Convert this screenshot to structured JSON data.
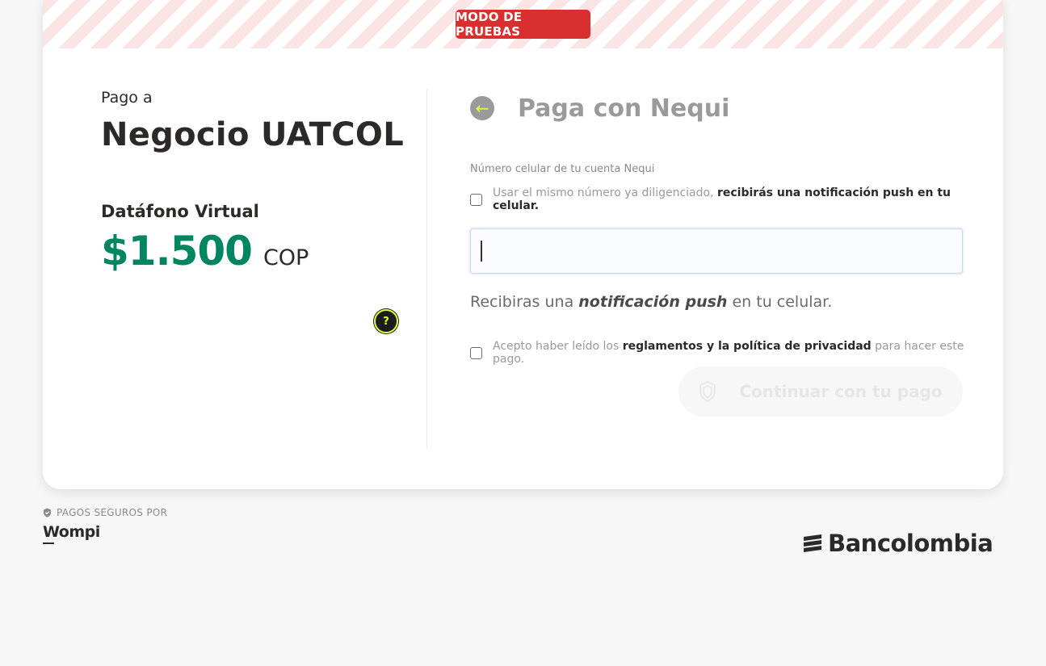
{
  "banner": {
    "test_mode_label": "MODO DE PRUEBAS"
  },
  "summary": {
    "pay_to_label": "Pago a",
    "merchant_name": "Negocio UATCOL",
    "product_name": "Datáfono Virtual",
    "amount": "$1.500",
    "currency": "COP",
    "help_icon": "?"
  },
  "payment": {
    "back_icon": "←",
    "title": "Paga con Nequi",
    "phone_label": "Número celular de tu cuenta Nequi",
    "same_number_text": "Usar el mismo número ya diligenciado,",
    "same_number_bold": "recibirás una notificación push en tu celular.",
    "phone_value": "",
    "push_info_prefix": "Recibiras una",
    "push_info_emphasis": "notificación push",
    "push_info_suffix": "en tu celular.",
    "terms_prefix": "Acepto haber leído los",
    "terms_bold": "reglamentos y la política de privacidad",
    "terms_suffix": "para hacer este pago.",
    "continue_label": "Continuar con tu pago"
  },
  "footer": {
    "secure_label": "PAGOS SEGUROS POR",
    "wompi_logo": "Wompi",
    "bancolombia_logo": "Bancolombia"
  },
  "colors": {
    "accent_green": "#008561",
    "test_badge_red": "#d9302f",
    "help_yellow": "#dfff3b"
  }
}
